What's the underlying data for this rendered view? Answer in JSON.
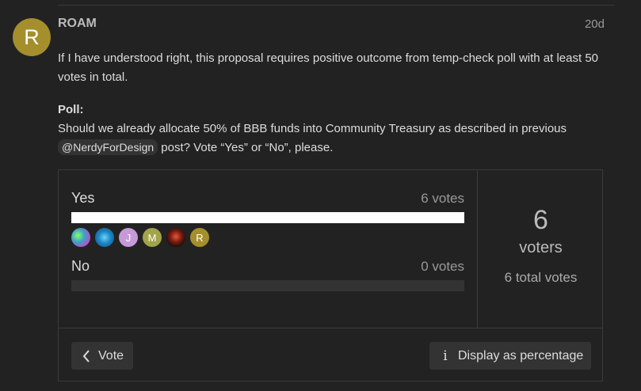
{
  "post": {
    "author": "ROAM",
    "avatar_letter": "R",
    "date": "20d",
    "paragraph1": "If I have understood right, this proposal requires positive outcome from temp-check poll with at least 50 votes in total.",
    "poll_heading": "Poll:",
    "question_before": "Should we already allocate 50% of BBB funds into Community Treasury as described in previous",
    "mention": "@NerdyForDesign",
    "question_after": " post? Vote “Yes” or “No”, please."
  },
  "poll": {
    "options": [
      {
        "label": "Yes",
        "votes_text": "6 votes",
        "fraction": 1.0
      },
      {
        "label": "No",
        "votes_text": "0 votes",
        "fraction": 0.0
      }
    ],
    "yes_voters": [
      {
        "letter": "",
        "icon": "abstract-avatar"
      },
      {
        "letter": "",
        "icon": "blue-texture-avatar"
      },
      {
        "letter": "J",
        "icon": "letter-avatar"
      },
      {
        "letter": "M",
        "icon": "letter-avatar"
      },
      {
        "letter": "",
        "icon": "dark-red-avatar"
      },
      {
        "letter": "R",
        "icon": "letter-avatar"
      }
    ],
    "voters_count": "6",
    "voters_label": "voters",
    "total_votes": "6 total votes",
    "vote_button": "Vote",
    "display_button": "Display as percentage"
  },
  "colors": {
    "background": "#222222",
    "accent_avatar": "#a58f2c",
    "bar_fill": "#ffffff",
    "bar_track": "#333333"
  }
}
